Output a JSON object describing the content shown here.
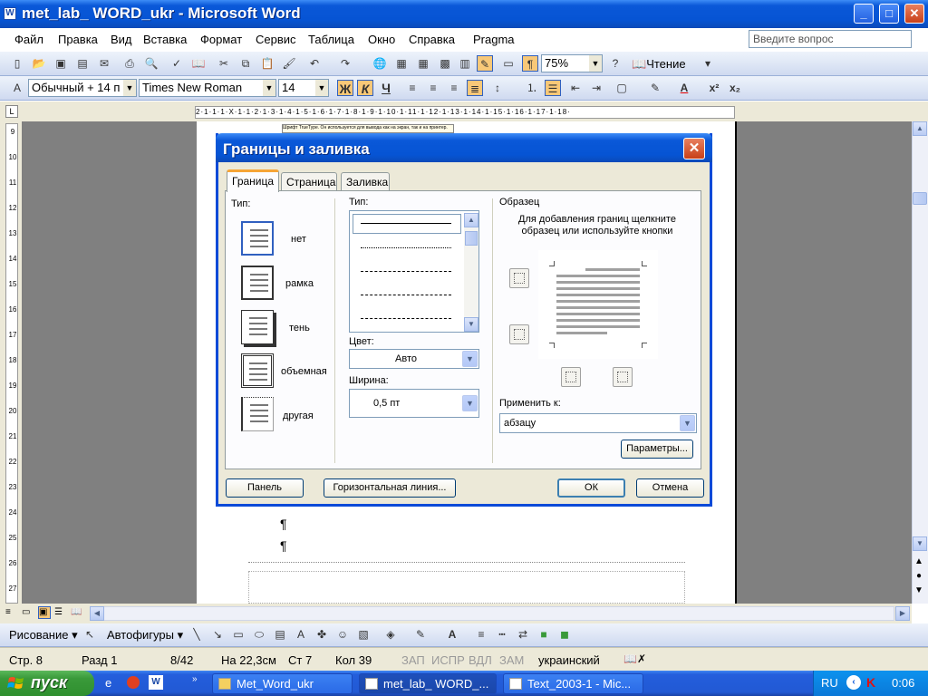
{
  "window": {
    "title": "met_lab_ WORD_ukr - Microsoft Word",
    "min": "_",
    "max": "□",
    "close": "✕"
  },
  "menu": {
    "items": [
      "Файл",
      "Правка",
      "Вид",
      "Вставка",
      "Формат",
      "Сервис",
      "Таблица",
      "Окно",
      "Справка",
      "Pragma"
    ],
    "ask_placeholder": "Введите вопрос"
  },
  "toolbar": {
    "zoom": "75%",
    "read_label": "Чтение"
  },
  "format_toolbar": {
    "style": "Обычный + 14 п",
    "font": "Times New Roman",
    "size": "14",
    "bold": "Ж",
    "italic": "К",
    "underline": "Ч"
  },
  "ruler": {
    "text": "2·1·1·1·X·1·1·2·1·3·1·4·1·5·1·6·1·7·1·8·1·9·1·10·1·11·1·12·1·13·1·14·1·15·1·16·1·17·1·18·"
  },
  "vruler": [
    "9",
    "10",
    "11",
    "12",
    "13",
    "14",
    "15",
    "16",
    "17",
    "18",
    "19",
    "20",
    "21",
    "22",
    "23",
    "24",
    "25",
    "26",
    "27"
  ],
  "document": {
    "pilcrow": "¶",
    "tooltip": "Шрифт TrueType. Он используется для вывода как на экран, так и на принтер."
  },
  "dialog": {
    "title": "Границы и заливка",
    "close": "✕",
    "tabs": [
      "Граница",
      "Страница",
      "Заливка"
    ],
    "type_label": "Тип:",
    "presets": [
      "нет",
      "рамка",
      "тень",
      "объемная",
      "другая"
    ],
    "style_label": "Тип:",
    "color_label": "Цвет:",
    "color_value": "Авто",
    "width_label": "Ширина:",
    "width_value": "0,5 пт",
    "sample_label": "Образец",
    "sample_hint_1": "Для добавления границ щелкните",
    "sample_hint_2": "образец или используйте кнопки",
    "apply_label": "Применить к:",
    "apply_value": "абзацу",
    "options_button": "Параметры...",
    "panel_button": "Панель",
    "hline_button": "Горизонтальная линия...",
    "ok_button": "ОК",
    "cancel_button": "Отмена"
  },
  "drawbar": {
    "draw": "Рисование",
    "autoshapes": "Автофигуры"
  },
  "status": {
    "page": "Стр. 8",
    "section": "Разд 1",
    "pages": "8/42",
    "at": "На 22,3см",
    "line": "Ст 7",
    "col": "Кол 39",
    "rec": "ЗАП",
    "trk": "ИСПР",
    "ext": "ВДЛ",
    "ovr": "ЗАМ",
    "lang": "украинский"
  },
  "taskbar": {
    "start": "пуск",
    "tasks": [
      "Met_Word_ukr",
      "met_lab_ WORD_...",
      "Text_2003-1 - Mic..."
    ],
    "lang": "RU",
    "time": "0:06"
  }
}
